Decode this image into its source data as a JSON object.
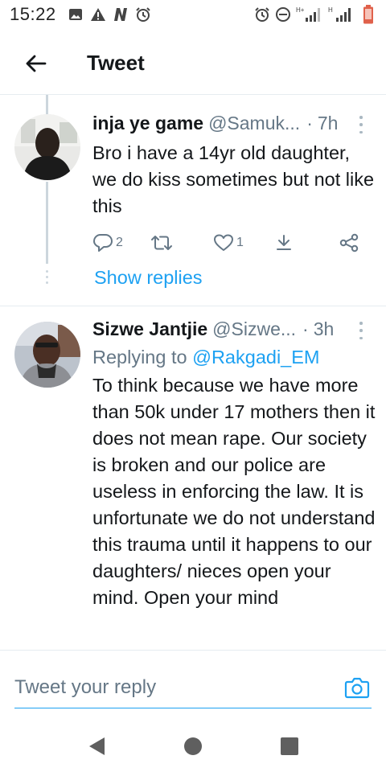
{
  "status_bar": {
    "time": "15:22",
    "left_icons": [
      "image-icon",
      "alert-triangle-icon",
      "n-app-icon",
      "alarm-icon"
    ],
    "right_icons": [
      "alarm-icon",
      "do-not-disturb-icon",
      "signal-h-plus-icon",
      "signal-h-icon",
      "battery-low-icon"
    ],
    "network_label_1": "H+",
    "network_label_2": "H",
    "battery_color": "#e0614b"
  },
  "header": {
    "title": "Tweet",
    "back_icon": "arrow-left-icon"
  },
  "tweets": [
    {
      "author_name": "inja ye game",
      "author_handle": "@Samuk...",
      "separator": "·",
      "time": "7h",
      "text": "Bro i have a 14yr old daughter, we do kiss sometimes but not like this",
      "replies_count": "2",
      "retweets_count": "",
      "likes_count": "1",
      "show_replies_label": "Show replies"
    },
    {
      "author_name": "Sizwe Jantjie",
      "author_handle": "@Sizwe...",
      "separator": "·",
      "time": "3h",
      "replying_prefix": "Replying to",
      "replying_to": "@Rakgadi_EM",
      "text": "To think because we have more than 50k under 17 mothers then it does not mean rape. Our society is broken and our police are useless in enforcing the law. It is unfortunate we do not understand this trauma until it happens to our daughters/ nieces open your mind. Open your mind"
    }
  ],
  "composer": {
    "placeholder": "Tweet your reply",
    "camera_icon": "camera-icon"
  },
  "nav_bar": {
    "icons": [
      "back-triangle-icon",
      "home-circle-icon",
      "recents-square-icon"
    ]
  },
  "colors": {
    "accent": "#1da1f2",
    "secondary_text": "#657786",
    "primary_text": "#14171a",
    "divider": "#e6ecf0"
  }
}
